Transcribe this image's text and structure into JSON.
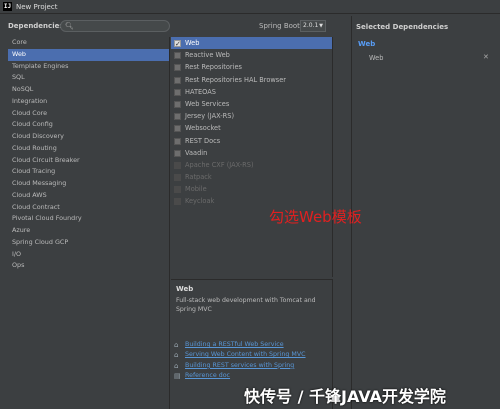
{
  "window": {
    "title": "New Project",
    "app_icon_text": "IJ"
  },
  "left": {
    "dependencies_label": "Dependencies",
    "search": {
      "icon": "search-icon",
      "value": ""
    },
    "spring_boot_label": "Spring Boot",
    "spring_boot_version": "2.0.1"
  },
  "categories": [
    "Core",
    "Web",
    "Template Engines",
    "SQL",
    "NoSQL",
    "Integration",
    "Cloud Core",
    "Cloud Config",
    "Cloud Discovery",
    "Cloud Routing",
    "Cloud Circuit Breaker",
    "Cloud Tracing",
    "Cloud Messaging",
    "Cloud AWS",
    "Cloud Contract",
    "Pivotal Cloud Foundry",
    "Azure",
    "Spring Cloud GCP",
    "I/O",
    "Ops"
  ],
  "selected_category": "Web",
  "items": [
    {
      "label": "Web",
      "checked": true,
      "disabled": false
    },
    {
      "label": "Reactive Web",
      "checked": false,
      "disabled": false
    },
    {
      "label": "Rest Repositories",
      "checked": false,
      "disabled": false
    },
    {
      "label": "Rest Repositories HAL Browser",
      "checked": false,
      "disabled": false
    },
    {
      "label": "HATEOAS",
      "checked": false,
      "disabled": false
    },
    {
      "label": "Web Services",
      "checked": false,
      "disabled": false
    },
    {
      "label": "Jersey (JAX-RS)",
      "checked": false,
      "disabled": false
    },
    {
      "label": "Websocket",
      "checked": false,
      "disabled": false
    },
    {
      "label": "REST Docs",
      "checked": false,
      "disabled": false
    },
    {
      "label": "Vaadin",
      "checked": false,
      "disabled": false
    },
    {
      "label": "Apache CXF (JAX-RS)",
      "checked": false,
      "disabled": true
    },
    {
      "label": "Ratpack",
      "checked": false,
      "disabled": true
    },
    {
      "label": "Mobile",
      "checked": false,
      "disabled": true
    },
    {
      "label": "Keycloak",
      "checked": false,
      "disabled": true
    }
  ],
  "description": {
    "title": "Web",
    "text": "Full-stack web development with Tomcat and Spring MVC",
    "links": [
      {
        "label": "Building a RESTful Web Service",
        "icon": "home-icon"
      },
      {
        "label": "Serving Web Content with Spring MVC",
        "icon": "home-icon"
      },
      {
        "label": "Building REST services with Spring",
        "icon": "home-icon"
      },
      {
        "label": "Reference doc",
        "icon": "book-icon"
      }
    ]
  },
  "right": {
    "selected_label": "Selected Dependencies",
    "group": "Web",
    "chosen": [
      "Web"
    ],
    "remove_icon": "✕"
  },
  "annotation": "勾选Web模板",
  "watermark": "快传号 / 千锋JAVA开发学院",
  "colors": {
    "accent": "#4b6eaf",
    "link": "#5896d6",
    "annotation": "#e02020"
  }
}
